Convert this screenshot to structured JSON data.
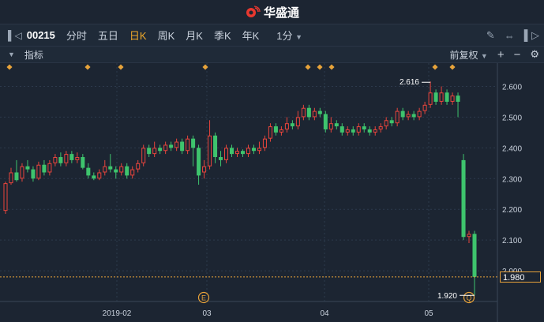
{
  "app": {
    "name": "华盛通",
    "brand_color": "#e8382f"
  },
  "toolbar": {
    "code": "00215",
    "tabs": [
      {
        "label": "分时",
        "active": false
      },
      {
        "label": "五日",
        "active": false
      },
      {
        "label": "日K",
        "active": true
      },
      {
        "label": "周K",
        "active": false
      },
      {
        "label": "月K",
        "active": false
      },
      {
        "label": "季K",
        "active": false
      },
      {
        "label": "年K",
        "active": false
      }
    ],
    "interval": "1分",
    "icons": [
      "panel-toggle-icon",
      "pen-icon",
      "expand-icon",
      "settings-icon"
    ]
  },
  "indicator_bar": {
    "label": "指标",
    "adjust": "前复权",
    "icons": [
      "plus-icon",
      "minus-icon",
      "gear-icon"
    ]
  },
  "chart": {
    "y_ticks": [
      "2.600",
      "2.500",
      "2.400",
      "2.300",
      "2.200",
      "2.100",
      "2.000"
    ],
    "x_ticks": [
      "2019-02",
      "03",
      "04",
      "05"
    ],
    "current_price": "1.980",
    "high_label": "2.616",
    "low_label": "1.920",
    "event_markers": [
      "E",
      "Q"
    ],
    "colors": {
      "up": "#e8453c",
      "down": "#3ec46d",
      "price_line": "#e8a33a",
      "grid": "#2c3a4c"
    }
  },
  "chart_data": {
    "type": "candlestick",
    "ylim": [
      1.9,
      2.65
    ],
    "candles": [
      [
        2.195,
        2.285,
        2.185,
        2.29
      ],
      [
        2.285,
        2.32,
        2.28,
        2.335
      ],
      [
        2.32,
        2.295,
        2.29,
        2.36
      ],
      [
        2.3,
        2.34,
        2.29,
        2.35
      ],
      [
        2.34,
        2.33,
        2.32,
        2.36
      ],
      [
        2.33,
        2.3,
        2.29,
        2.34
      ],
      [
        2.3,
        2.345,
        2.295,
        2.355
      ],
      [
        2.345,
        2.32,
        2.31,
        2.36
      ],
      [
        2.32,
        2.35,
        2.31,
        2.36
      ],
      [
        2.35,
        2.37,
        2.34,
        2.38
      ],
      [
        2.37,
        2.35,
        2.34,
        2.385
      ],
      [
        2.35,
        2.38,
        2.34,
        2.39
      ],
      [
        2.38,
        2.36,
        2.35,
        2.39
      ],
      [
        2.36,
        2.37,
        2.35,
        2.385
      ],
      [
        2.37,
        2.335,
        2.33,
        2.38
      ],
      [
        2.335,
        2.31,
        2.3,
        2.35
      ],
      [
        2.31,
        2.3,
        2.295,
        2.32
      ],
      [
        2.3,
        2.32,
        2.295,
        2.33
      ],
      [
        2.32,
        2.34,
        2.31,
        2.36
      ],
      [
        2.34,
        2.33,
        2.32,
        2.38
      ],
      [
        2.33,
        2.32,
        2.3,
        2.34
      ],
      [
        2.32,
        2.34,
        2.31,
        2.35
      ],
      [
        2.34,
        2.31,
        2.3,
        2.35
      ],
      [
        2.31,
        2.33,
        2.3,
        2.34
      ],
      [
        2.33,
        2.35,
        2.32,
        2.36
      ],
      [
        2.35,
        2.4,
        2.34,
        2.41
      ],
      [
        2.4,
        2.38,
        2.37,
        2.41
      ],
      [
        2.38,
        2.4,
        2.37,
        2.42
      ],
      [
        2.4,
        2.39,
        2.38,
        2.41
      ],
      [
        2.39,
        2.41,
        2.38,
        2.42
      ],
      [
        2.41,
        2.4,
        2.39,
        2.42
      ],
      [
        2.4,
        2.42,
        2.39,
        2.43
      ],
      [
        2.42,
        2.39,
        2.38,
        2.43
      ],
      [
        2.39,
        2.43,
        2.38,
        2.44
      ],
      [
        2.43,
        2.4,
        2.34,
        2.44
      ],
      [
        2.4,
        2.31,
        2.28,
        2.41
      ],
      [
        2.32,
        2.34,
        2.3,
        2.36
      ],
      [
        2.34,
        2.44,
        2.33,
        2.49
      ],
      [
        2.44,
        2.37,
        2.35,
        2.45
      ],
      [
        2.37,
        2.36,
        2.34,
        2.39
      ],
      [
        2.36,
        2.4,
        2.35,
        2.41
      ],
      [
        2.4,
        2.38,
        2.37,
        2.41
      ],
      [
        2.38,
        2.39,
        2.37,
        2.4
      ],
      [
        2.39,
        2.38,
        2.37,
        2.395
      ],
      [
        2.38,
        2.4,
        2.37,
        2.41
      ],
      [
        2.4,
        2.39,
        2.38,
        2.41
      ],
      [
        2.39,
        2.4,
        2.38,
        2.42
      ],
      [
        2.4,
        2.43,
        2.39,
        2.44
      ],
      [
        2.43,
        2.47,
        2.42,
        2.48
      ],
      [
        2.47,
        2.45,
        2.44,
        2.48
      ],
      [
        2.45,
        2.46,
        2.44,
        2.47
      ],
      [
        2.46,
        2.48,
        2.45,
        2.5
      ],
      [
        2.48,
        2.47,
        2.46,
        2.49
      ],
      [
        2.47,
        2.5,
        2.46,
        2.52
      ],
      [
        2.5,
        2.53,
        2.49,
        2.54
      ],
      [
        2.53,
        2.5,
        2.49,
        2.54
      ],
      [
        2.5,
        2.52,
        2.49,
        2.53
      ],
      [
        2.52,
        2.51,
        2.5,
        2.53
      ],
      [
        2.51,
        2.46,
        2.45,
        2.52
      ],
      [
        2.46,
        2.48,
        2.45,
        2.5
      ],
      [
        2.48,
        2.47,
        2.46,
        2.49
      ],
      [
        2.47,
        2.45,
        2.44,
        2.48
      ],
      [
        2.45,
        2.46,
        2.44,
        2.47
      ],
      [
        2.46,
        2.45,
        2.44,
        2.47
      ],
      [
        2.45,
        2.47,
        2.44,
        2.48
      ],
      [
        2.47,
        2.46,
        2.45,
        2.48
      ],
      [
        2.46,
        2.45,
        2.44,
        2.47
      ],
      [
        2.45,
        2.46,
        2.44,
        2.47
      ],
      [
        2.46,
        2.47,
        2.45,
        2.48
      ],
      [
        2.47,
        2.49,
        2.46,
        2.5
      ],
      [
        2.49,
        2.48,
        2.47,
        2.5
      ],
      [
        2.48,
        2.52,
        2.47,
        2.53
      ],
      [
        2.52,
        2.5,
        2.49,
        2.53
      ],
      [
        2.5,
        2.51,
        2.49,
        2.52
      ],
      [
        2.51,
        2.5,
        2.49,
        2.52
      ],
      [
        2.5,
        2.52,
        2.49,
        2.53
      ],
      [
        2.52,
        2.54,
        2.51,
        2.55
      ],
      [
        2.54,
        2.58,
        2.53,
        2.616
      ],
      [
        2.58,
        2.55,
        2.54,
        2.59
      ],
      [
        2.55,
        2.58,
        2.54,
        2.6
      ],
      [
        2.58,
        2.55,
        2.54,
        2.59
      ],
      [
        2.55,
        2.57,
        2.54,
        2.58
      ],
      [
        2.57,
        2.55,
        2.5,
        2.58
      ],
      [
        2.36,
        2.11,
        2.1,
        2.38
      ],
      [
        2.11,
        2.12,
        2.09,
        2.13
      ],
      [
        2.12,
        1.98,
        1.92,
        2.13
      ]
    ]
  }
}
